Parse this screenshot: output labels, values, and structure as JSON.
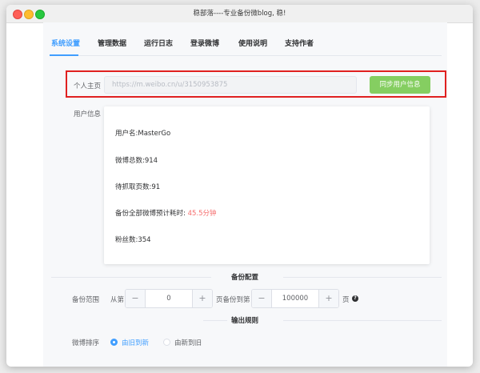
{
  "window": {
    "title": "稳部落----专业备份微blog, 稳!"
  },
  "tabs": [
    {
      "label": "系统设置",
      "active": true
    },
    {
      "label": "管理数据"
    },
    {
      "label": "运行日志"
    },
    {
      "label": "登录微博"
    },
    {
      "label": "使用说明"
    },
    {
      "label": "支持作者"
    }
  ],
  "profile": {
    "label": "个人主页",
    "url_placeholder": "https://m.weibo.cn/u/3150953875",
    "sync_button": "同步用户信息"
  },
  "user_info": {
    "label": "用户信息",
    "username": "用户名:MasterGo",
    "weibo_count": "微博总数:914",
    "pages_pending": "待抓取页数:91",
    "estimate_prefix": "备份全部微博预计耗时:",
    "estimate_value": "45.5分钟",
    "followers": "粉丝数:354"
  },
  "backup_config": {
    "section_title": "备份配置",
    "range_label": "备份范围",
    "from_text": "从第",
    "from_value": "0",
    "to_text": "页备份到第",
    "to_value": "100000",
    "page_suffix": "页",
    "minus": "−",
    "plus": "+",
    "help_icon": "question-mark"
  },
  "output_rules": {
    "section_title": "输出规则",
    "sort_label": "微博排序",
    "options": [
      {
        "label": "由旧到新",
        "checked": true
      },
      {
        "label": "由新到旧",
        "checked": false
      }
    ]
  },
  "colors": {
    "accent": "#409eff",
    "sync_button": "#85ce61",
    "highlight_border": "#e02020",
    "estimate": "#f56c6c"
  }
}
